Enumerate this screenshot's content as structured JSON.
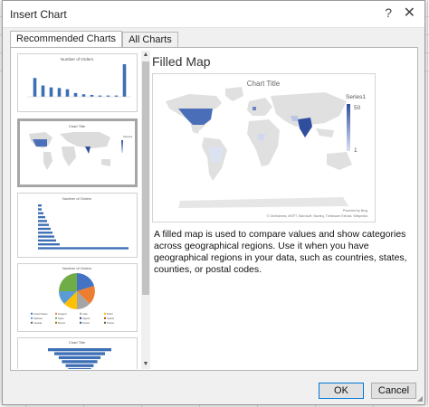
{
  "dialog": {
    "title": "Insert Chart",
    "help_glyph": "?",
    "close_glyph": "✕",
    "tabs": [
      {
        "label": "Recommended Charts",
        "active": true
      },
      {
        "label": "All Charts",
        "active": false
      }
    ],
    "preview": {
      "name": "Filled Map",
      "description": "A filled map is used to compare values and show categories across geographical regions. Use it when you have geographical regions in your data, such as countries, states, counties, or postal codes."
    },
    "buttons": {
      "ok": "OK",
      "cancel": "Cancel"
    }
  },
  "chart_data": [
    {
      "type": "bar",
      "title": "Number of Orders",
      "values": [
        30,
        18,
        15,
        14,
        12,
        6,
        4,
        3,
        2,
        2,
        2,
        52
      ]
    },
    {
      "type": "map",
      "title": "Chart Title",
      "legend": {
        "series": "Series1",
        "max": 50,
        "min": 1,
        "min_color": "#dbe3f3",
        "max_color": "#2f4f9e"
      },
      "footer": [
        "Powered by Bing",
        "© GeoNames, MSFT, Microsoft, Navteq, Thinkware Extract, Wikipedia"
      ]
    },
    {
      "type": "bar",
      "orientation": "horizontal",
      "title": "Number of Orders",
      "values": [
        50,
        12,
        10,
        9,
        8,
        7,
        6,
        5,
        4,
        3,
        2,
        2
      ]
    },
    {
      "type": "pie",
      "title": "Number of Orders",
      "legend_items": [
        "United States",
        "England",
        "India",
        "Brazil",
        "Pakistan",
        "Spain",
        "Nigeria",
        "Ireland",
        "Canada",
        "Mexico",
        "France",
        "Ghana"
      ]
    },
    {
      "type": "funnel",
      "title": "Chart Title",
      "values": [
        50,
        40,
        33,
        28,
        22,
        18,
        14,
        10
      ]
    }
  ],
  "colors": {
    "accent": "#0078d7",
    "bar": "#3d6fb5",
    "map_land": "#e0e0e0"
  }
}
